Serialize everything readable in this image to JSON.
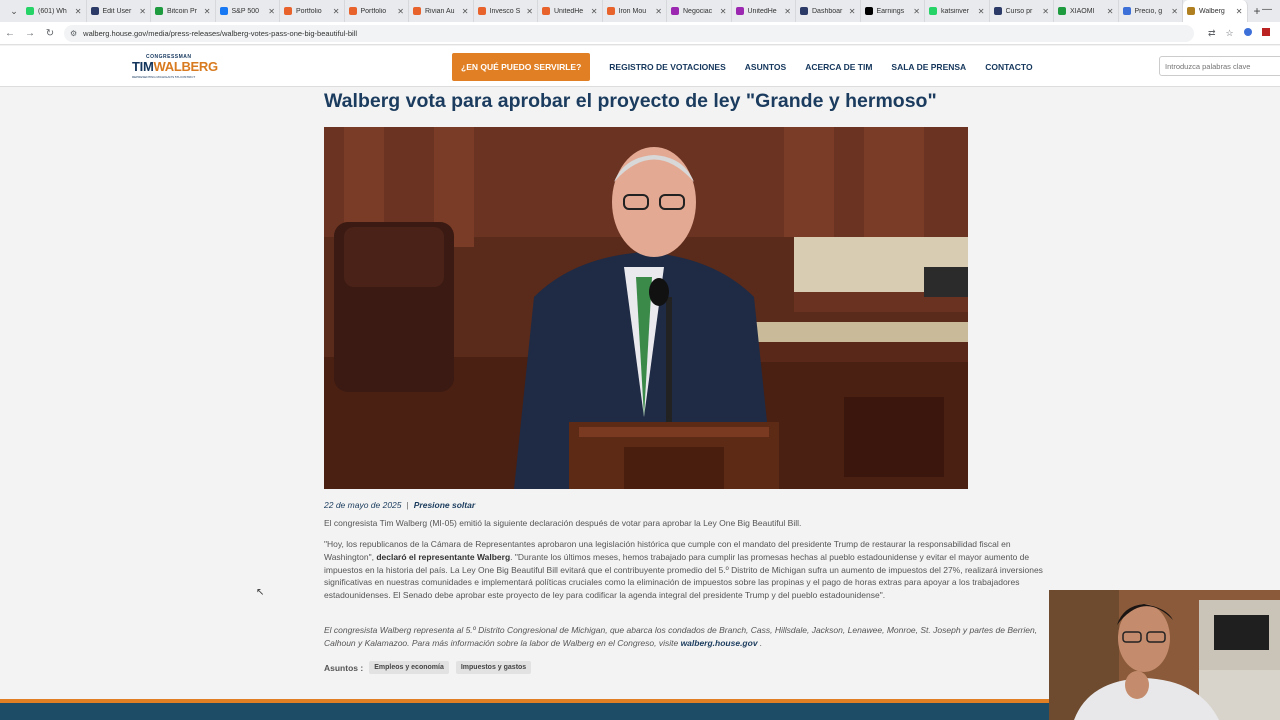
{
  "browser": {
    "tabs": [
      {
        "title": "(601) Wh",
        "color": "#25d366"
      },
      {
        "title": "Edit User",
        "color": "#2b3a67"
      },
      {
        "title": "Bitcoin Pr",
        "color": "#1d9b3e"
      },
      {
        "title": "S&P 500",
        "color": "#1877f2"
      },
      {
        "title": "Portfolio",
        "color": "#e8632b"
      },
      {
        "title": "Portfolio",
        "color": "#e8632b"
      },
      {
        "title": "Rivian Au",
        "color": "#e8632b"
      },
      {
        "title": "Invesco S",
        "color": "#e8632b"
      },
      {
        "title": "UnitedHe",
        "color": "#e8632b"
      },
      {
        "title": "Iron Mou",
        "color": "#e8632b"
      },
      {
        "title": "Negociac",
        "color": "#9c27b0"
      },
      {
        "title": "UnitedHe",
        "color": "#9c27b0"
      },
      {
        "title": "Dashboar",
        "color": "#2b3a67"
      },
      {
        "title": "Earnings",
        "color": "#000000"
      },
      {
        "title": "katsinver",
        "color": "#25d366"
      },
      {
        "title": "Curso pr",
        "color": "#2b3a67"
      },
      {
        "title": "XIAOMI",
        "color": "#1d9b3e"
      },
      {
        "title": "Precio, g",
        "color": "#3c6fd8"
      },
      {
        "title": "Walberg",
        "color": "#b08020",
        "active": true
      }
    ],
    "url": "walberg.house.gov/media/press-releases/walberg-votes-pass-one-big-beautiful-bill"
  },
  "site": {
    "logo_small": "CONGRESSMAN",
    "logo_first": "TIM",
    "logo_last": "WALBERG",
    "logo_sub": "REPRESENTING MICHIGAN'S 5TH DISTRICT",
    "cta": "¿EN QUÉ PUEDO SERVIRLE?",
    "nav": [
      "REGISTRO DE VOTACIONES",
      "ASUNTOS",
      "ACERCA DE TIM",
      "SALA DE PRENSA",
      "CONTACTO"
    ],
    "search_placeholder": "Introduzca palabras clave"
  },
  "article": {
    "title": "Walberg vota para aprobar el proyecto de ley \"Grande y hermoso\"",
    "date": "22 de mayo de 2025",
    "separator": "|",
    "category": "Presione soltar",
    "p1": "El congresista Tim Walberg (MI-05) emitió la siguiente declaración después de votar para aprobar la Ley One Big Beautiful Bill.",
    "p2_a": "\"Hoy, los republicanos de la Cámara de Representantes aprobaron una legislación histórica que cumple con el mandato del presidente Trump de restaurar la responsabilidad fiscal en Washington\", ",
    "p2_bold": "declaró el representante Walberg",
    "p2_b": ". \"Durante los últimos meses, hemos trabajado para cumplir las promesas hechas al pueblo estadounidense y evitar el mayor aumento de impuestos en la historia del país. La Ley One Big Beautiful Bill evitará que el contribuyente promedio del 5.º Distrito de Michigan sufra un aumento de impuestos del 27%, realizará inversiones significativas en nuestras comunidades e implementará políticas cruciales como la eliminación de impuestos sobre las propinas y el pago de horas extras para apoyar a los trabajadores estadounidenses. El Senado debe aprobar este proyecto de ley para codificar la agenda integral del presidente Trump y del pueblo estadounidense\".",
    "p3": "El congresista Walberg representa al 5.º Distrito Congresional de Michigan, que abarca los condados de Branch, Cass, Hillsdale, Jackson, Lenawee, Monroe, St. Joseph y partes de Berrien, Calhoun y Kalamazoo. Para más información sobre la labor de Walberg en el Congreso, visite ",
    "p3_link": "walberg.house.gov",
    "p3_end": " .",
    "topics_label": "Asuntos :",
    "topics": [
      "Empleos y economía",
      "Impuestos y gastos"
    ]
  }
}
